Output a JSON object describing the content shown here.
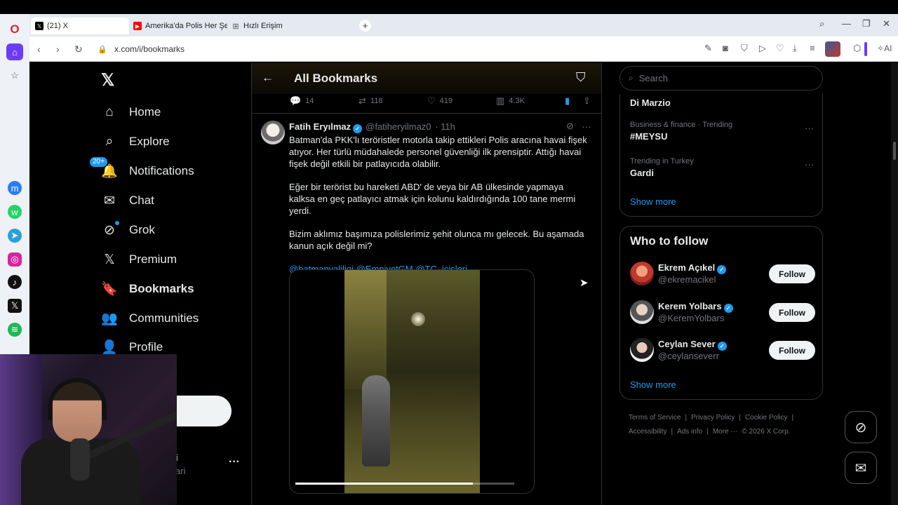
{
  "browser": {
    "tabs": [
      {
        "label": "(21) X",
        "active": true
      },
      {
        "label": "Amerika'da Polis Her Şeyi",
        "active": false
      },
      {
        "label": "Hızlı Erişim",
        "active": false
      }
    ],
    "url": "x.com/i/bookmarks",
    "ai_label": "AI"
  },
  "nav": {
    "logo": "X",
    "items": [
      {
        "label": "Home",
        "icon": "home-icon"
      },
      {
        "label": "Explore",
        "icon": "search-icon"
      },
      {
        "label": "Notifications",
        "icon": "bell-icon",
        "badge": "20+"
      },
      {
        "label": "Chat",
        "icon": "mail-icon"
      },
      {
        "label": "Grok",
        "icon": "grok-icon"
      },
      {
        "label": "Premium",
        "icon": "x-icon"
      },
      {
        "label": "Bookmarks",
        "icon": "bookmark-icon"
      },
      {
        "label": "Communities",
        "icon": "people-icon"
      },
      {
        "label": "Profile",
        "icon": "person-icon"
      }
    ],
    "account_name": "i",
    "account_handle": "ari"
  },
  "header": {
    "title": "All Bookmarks"
  },
  "prev_tweet_actions": {
    "replies": "14",
    "reposts": "118",
    "likes": "419",
    "views": "4.3K"
  },
  "tweet": {
    "author": "Fatih Eryılmaz",
    "handle": "@fatiheryilmaz0",
    "time": "· 11h",
    "paragraphs": [
      "Batman'da PKK'lı teröristler motorla takip ettikleri Polis aracına havai fişek atıyor. Her türlü müdahalede personel güvenliği ilk prensiptir. Attığı havai fişek değil etkili bir patlayıcıda olabilir.",
      "Eğer bir terörist bu hareketi ABD' de veya bir AB ülkesinde yapmaya kalksa en geç patlayıcı atmak için kolunu kaldırdığında 100 tane mermi yerdi.",
      "Bizim aklımız başımıza polislerimiz şehit olunca mı gelecek. Bu aşamada kanun açık değil mi?"
    ],
    "mentions": "@batmanvaliligi @EmniyetGM @TC_icisleri",
    "video_progress": 0.81
  },
  "sidebar": {
    "search_placeholder": "Search",
    "trends": [
      {
        "meta": "",
        "topic": "Di Marzio"
      },
      {
        "meta": "Business & finance · Trending",
        "topic": "#MEYSU"
      },
      {
        "meta": "Trending in Turkey",
        "topic": "Gardi"
      }
    ],
    "show_more": "Show more",
    "who_to_follow_title": "Who to follow",
    "people": [
      {
        "name": "Ekrem Açıkel",
        "handle": "@ekremacikel",
        "follow": "Follow"
      },
      {
        "name": "Kerem Yolbars",
        "handle": "@KeremYolbars",
        "follow": "Follow"
      },
      {
        "name": "Ceylan Sever",
        "handle": "@ceylanseverr",
        "follow": "Follow"
      }
    ],
    "show_more_2": "Show more",
    "footer": [
      "Terms of Service",
      "|",
      "Privacy Policy",
      "|",
      "Cookie Policy",
      "|",
      "Accessibility",
      "|",
      "Ads info",
      "|",
      "More ···",
      "© 2026 X Corp."
    ]
  },
  "colors": {
    "accent": "#1d9bf0",
    "background": "#000000",
    "text": "#e7e9ea",
    "muted": "#71767b"
  }
}
